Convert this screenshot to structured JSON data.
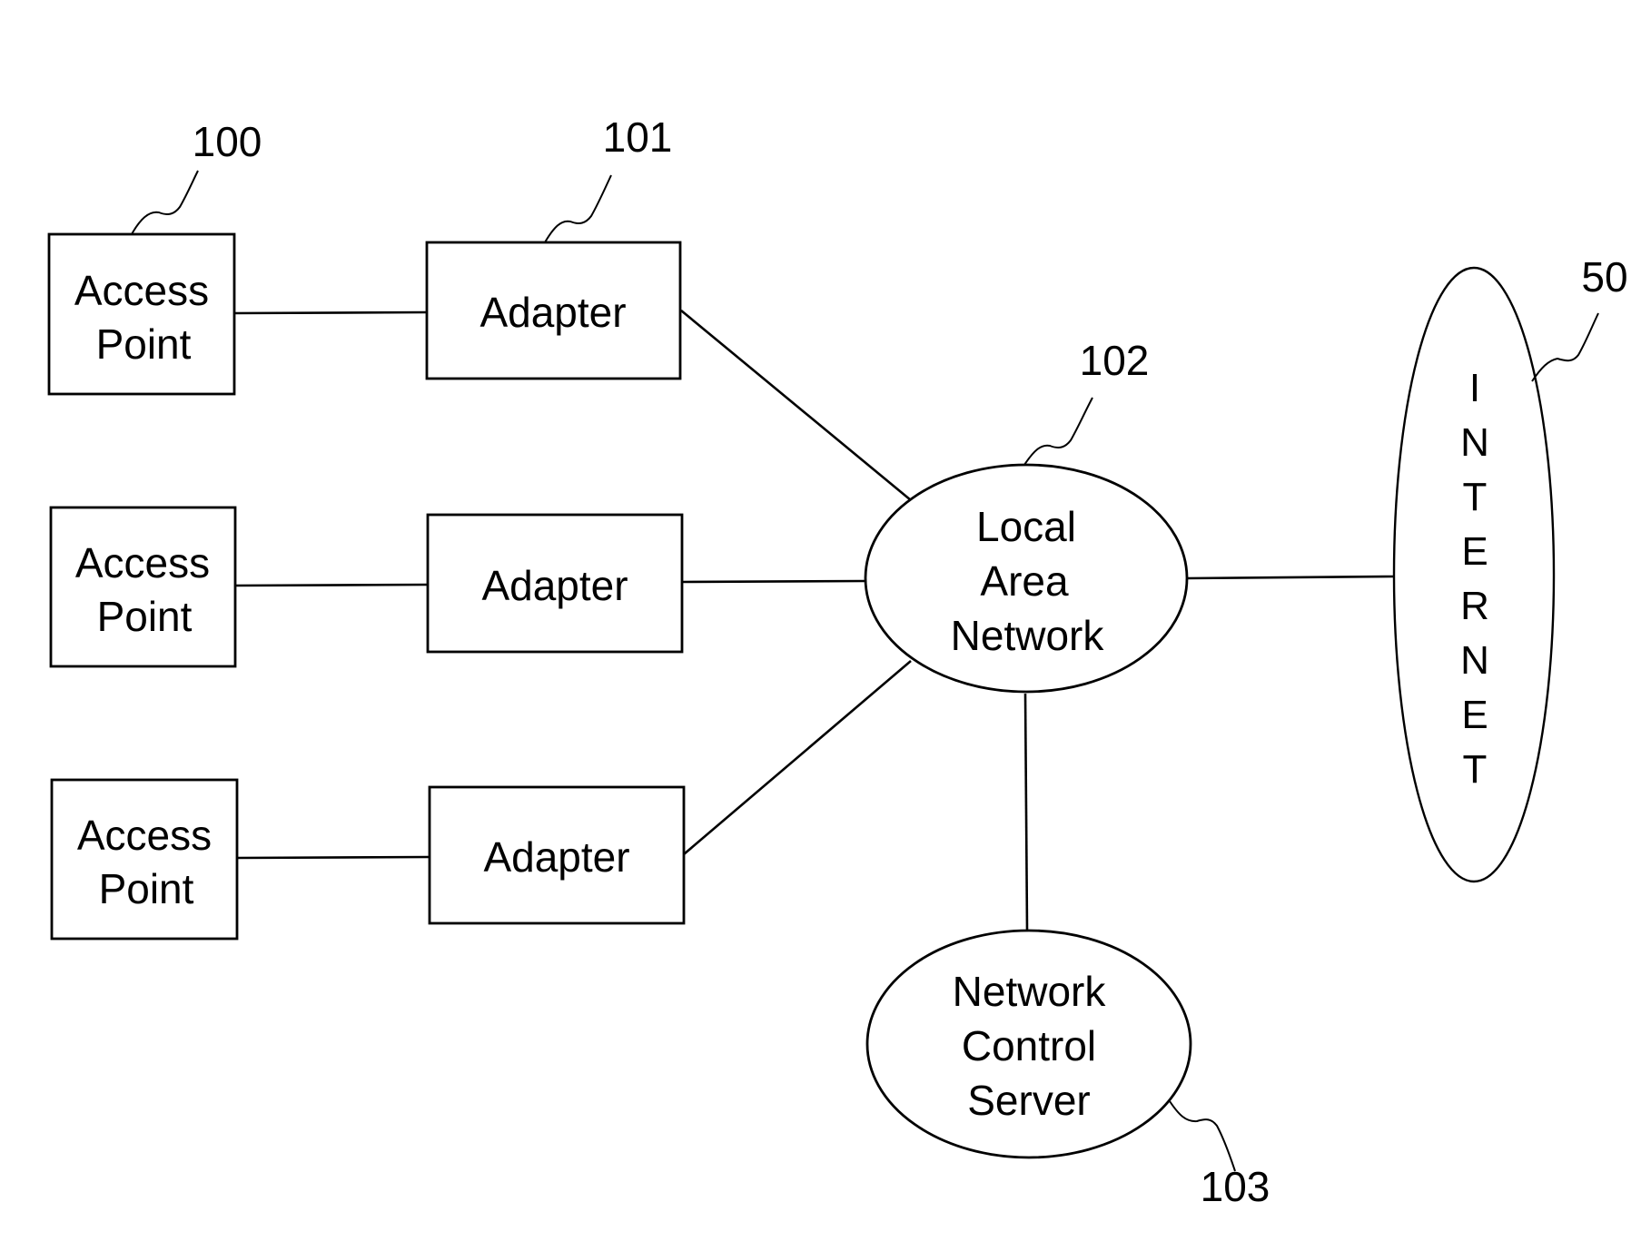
{
  "diagram": {
    "type": "network-block-diagram",
    "nodes": {
      "access_points": [
        {
          "label_line1": "Access",
          "label_line2": "Point",
          "ref": "100"
        },
        {
          "label_line1": "Access",
          "label_line2": "Point"
        },
        {
          "label_line1": "Access",
          "label_line2": "Point"
        }
      ],
      "adapters": [
        {
          "label": "Adapter",
          "ref": "101"
        },
        {
          "label": "Adapter"
        },
        {
          "label": "Adapter"
        }
      ],
      "lan": {
        "label_line1": "Local",
        "label_line2": "Area",
        "label_line3": "Network",
        "ref": "102"
      },
      "internet": {
        "label": "INTERNET",
        "letters": [
          "I",
          "N",
          "T",
          "E",
          "R",
          "N",
          "E",
          "T"
        ],
        "ref": "50"
      },
      "server": {
        "label_line1": "Network",
        "label_line2": "Control",
        "label_line3": "Server",
        "ref": "103"
      }
    },
    "edges": [
      [
        "access_point_1",
        "adapter_1"
      ],
      [
        "access_point_2",
        "adapter_2"
      ],
      [
        "access_point_3",
        "adapter_3"
      ],
      [
        "adapter_1",
        "lan"
      ],
      [
        "adapter_2",
        "lan"
      ],
      [
        "adapter_3",
        "lan"
      ],
      [
        "lan",
        "internet"
      ],
      [
        "lan",
        "server"
      ]
    ]
  }
}
